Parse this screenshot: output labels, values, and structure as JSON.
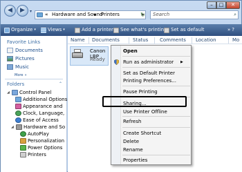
{
  "address": {
    "chevron": "«",
    "crumb1": "Hardware and Sound",
    "sep": "▸",
    "crumb2": "Printers"
  },
  "search": {
    "placeholder": "Search"
  },
  "toolbar": {
    "organize": "Organize",
    "views": "Views",
    "add_printer": "Add a printer",
    "see_printing": "See what's printing",
    "set_default": "Set as default"
  },
  "leftpane": {
    "favorites_title": "Favorite Links",
    "favorites": [
      "Documents",
      "Pictures",
      "Music"
    ],
    "more": "More",
    "folders_title": "Folders",
    "tree": [
      "Control Panel",
      "Additional Options",
      "Appearance and",
      "Clock, Language,",
      "Ease of Access",
      "Hardware and So",
      "AutoPlay",
      "Personalization",
      "Power Options",
      "Printers"
    ]
  },
  "columns": [
    "Name",
    "Documents",
    "Status",
    "Comments",
    "Location",
    "Mo"
  ],
  "printer": {
    "name": "Canon LBP",
    "status": "Ready"
  },
  "menu": {
    "items": [
      "Open",
      "Run as administrator",
      "Set as Default Printer",
      "Printing Preferences...",
      "Pause Printing",
      "Sharing...",
      "Use Printer Offline",
      "Refresh",
      "Create Shortcut",
      "Delete",
      "Rename",
      "Properties"
    ]
  },
  "colors": {
    "toolbar": "#3c5f92",
    "link": "#1a4c8b",
    "selection": "#d9e8f8"
  }
}
